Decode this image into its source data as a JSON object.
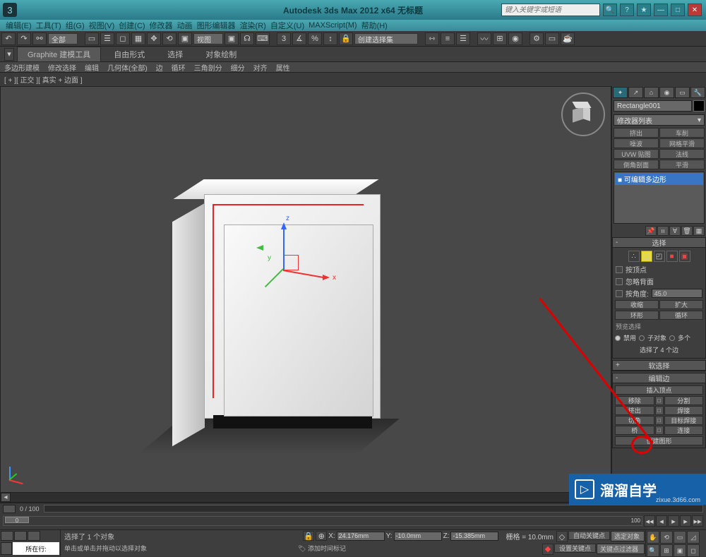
{
  "title": "Autodesk 3ds Max 2012 x64   无标题",
  "search_placeholder": "键入关键字或短语",
  "menus": [
    "编辑(E)",
    "工具(T)",
    "组(G)",
    "视图(V)",
    "创建(C)",
    "修改器",
    "动画",
    "图形编辑器",
    "渲染(R)",
    "自定义(U)",
    "MAXScript(M)",
    "帮助(H)"
  ],
  "toolbar2_combo1": "全部",
  "toolbar2_combo2": "视图",
  "toolbar2_combo3": "创建选择集",
  "ribbon_tabs": [
    "Graphite 建模工具",
    "自由形式",
    "选择",
    "对象绘制"
  ],
  "sub_tabs": [
    "多边形建模",
    "修改选择",
    "编辑",
    "几何体(全部)",
    "边",
    "循环",
    "三角剖分",
    "细分",
    "对齐",
    "属性"
  ],
  "viewport_label": "[ + ][ 正交 ][ 真实 + 边面 ]",
  "axes": {
    "x": "x",
    "y": "y",
    "z": "z"
  },
  "object_name": "Rectangle001",
  "mod_dropdown": "修改器列表",
  "mod_buttons": [
    "挤出",
    "车削",
    "噪波",
    "网格平滑",
    "UVW 贴图",
    "法线",
    "倒角剖面",
    "平滑"
  ],
  "mod_stack_item": "■ 可编辑多边形",
  "rollout_select": "选择",
  "chk1": "按顶点",
  "chk2": "忽略背面",
  "chk3_label": "按角度:",
  "chk3_val": "45.0",
  "buttons_12": [
    "收缩",
    "扩大"
  ],
  "buttons_34": [
    "环形",
    "循环"
  ],
  "preview_label": "预览选择",
  "radios": [
    "禁用",
    "子对象",
    "多个"
  ],
  "sel_info": "选择了 4 个边",
  "rollout_soft": "软选择",
  "rollout_edit": "编辑边",
  "edit_btns": {
    "r1": "插入顶点",
    "r2a": "移除",
    "r2b": "分割",
    "r3a": "挤出",
    "r3b": "焊接",
    "r4a": "切角",
    "r4b": "目标焊接",
    "r5a": "桥",
    "r5b": "连接",
    "r6": "创建图形"
  },
  "timeline_label": "0 / 100",
  "time_end": "100",
  "status_selected": "选择了 1 个对象",
  "status_hint": "单击或单击并拖动以选择对象",
  "coords": {
    "x_label": "X:",
    "x": "24.176mm",
    "y_label": "Y:",
    "y": "-10.0mm",
    "z_label": "Z:",
    "z": "-15.385mm",
    "grid_label": "栅格 = 10.0mm"
  },
  "loc_label": "所在行:",
  "auto_key": "自动关键点",
  "set_key": "设置关键点",
  "sel_obj": "选定对象",
  "key_filter": "关键点过滤器",
  "add_tag": "添加时间标记",
  "watermark_text": "溜溜自学",
  "watermark_url": "zixue.3d66.com"
}
